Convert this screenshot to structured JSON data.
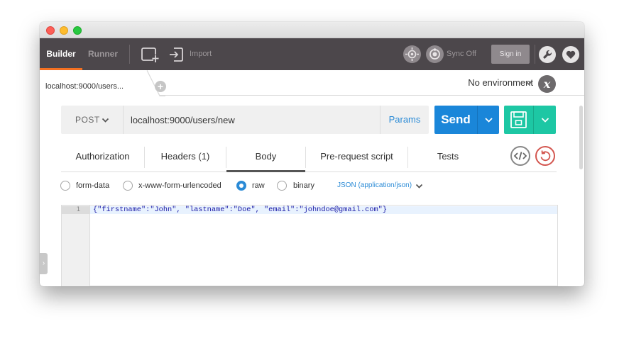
{
  "toolbar": {
    "builder_label": "Builder",
    "runner_label": "Runner",
    "import_label": "Import",
    "sync_label": "Sync Off",
    "signin_label": "Sign in",
    "accent_color": "#f37021",
    "background_color": "#4c474b"
  },
  "tabs": {
    "active_request_label": "localhost:9000/users...",
    "add_tab_symbol": "+"
  },
  "environment": {
    "selected": "No environment",
    "quicklook_symbol": "x"
  },
  "request": {
    "method": "POST",
    "url": "localhost:9000/users/new",
    "params_label": "Params",
    "send_label": "Send",
    "send_color": "#1a86d9",
    "save_color": "#1dc7a4"
  },
  "request_tabs": [
    {
      "label": "Authorization"
    },
    {
      "label": "Headers (1)"
    },
    {
      "label": "Body",
      "active": true
    },
    {
      "label": "Pre-request script"
    },
    {
      "label": "Tests"
    }
  ],
  "body_modes": [
    {
      "label": "form-data",
      "checked": false
    },
    {
      "label": "x-www-form-urlencoded",
      "checked": false
    },
    {
      "label": "raw",
      "checked": true
    },
    {
      "label": "binary",
      "checked": false
    }
  ],
  "content_type": "JSON (application/json)",
  "editor": {
    "line_number": "1",
    "line_1": "{\"firstname\":\"John\", \"lastname\":\"Doe\", \"email\":\"johndoe@gmail.com\"}"
  },
  "icons": {
    "new_window": "new-window-icon",
    "import": "import-icon",
    "interceptor": "interceptor-icon",
    "sync": "sync-icon",
    "settings": "wrench-icon",
    "support": "heart-icon",
    "code": "code-icon",
    "reset": "reset-icon",
    "save": "floppy-icon"
  }
}
